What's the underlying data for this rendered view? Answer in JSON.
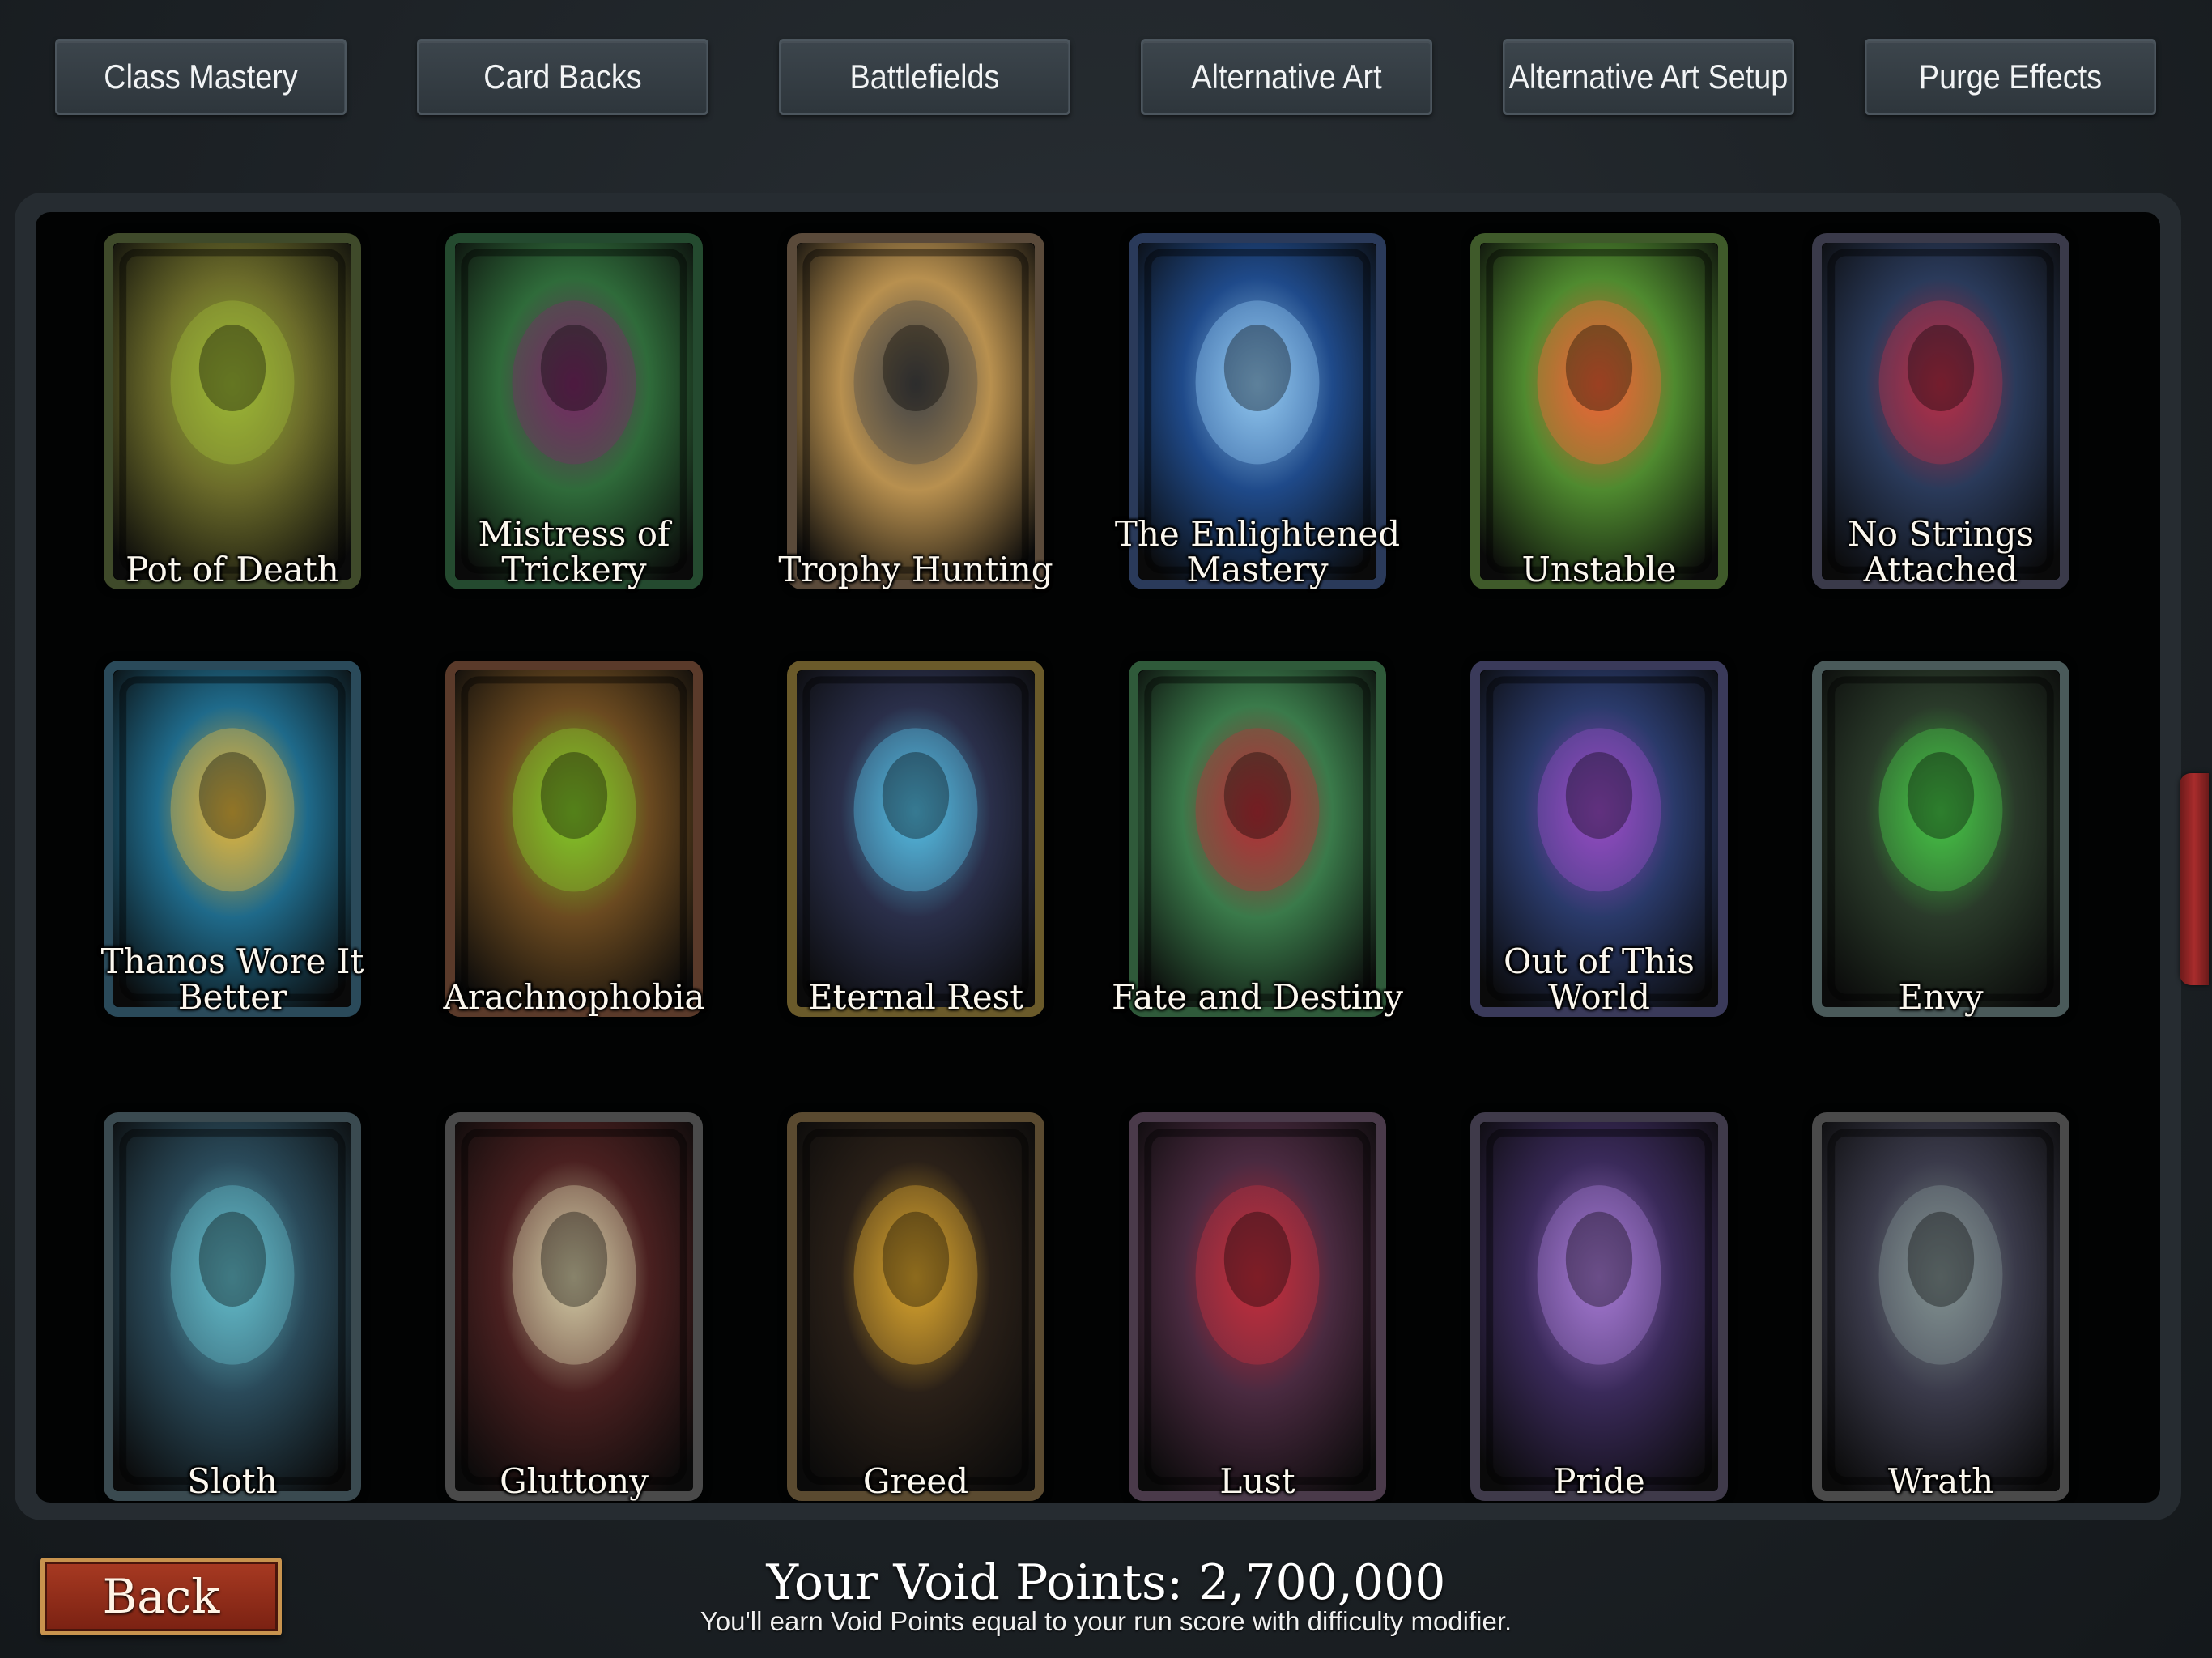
{
  "tabs": [
    {
      "label": "Class Mastery",
      "icon": "tab"
    },
    {
      "label": "Card Backs",
      "icon": "tab"
    },
    {
      "label": "Battlefields",
      "icon": "tab"
    },
    {
      "label": "Alternative Art",
      "icon": "tab"
    },
    {
      "label": "Alternative Art Setup",
      "icon": "tab"
    },
    {
      "label": "Purge Effects",
      "icon": "tab"
    }
  ],
  "cards": [
    {
      "name": "Pot of Death",
      "frame": "#3f4a2a",
      "bg": "#6b6b2a",
      "accent": "#a5c23a"
    },
    {
      "name": "Mistress of Trickery",
      "frame": "#244a2f",
      "bg": "#2f6b3a",
      "accent": "#7f2a6a"
    },
    {
      "name": "Trophy Hunting",
      "frame": "#5a4a3a",
      "bg": "#b8904f",
      "accent": "#4a4a4a"
    },
    {
      "name": "The Enlightened Mastery",
      "frame": "#2a3a5a",
      "bg": "#1f4a8a",
      "accent": "#9ad4ff"
    },
    {
      "name": "Unstable",
      "frame": "#3f5a2a",
      "bg": "#4f8a2f",
      "accent": "#ff6a3a"
    },
    {
      "name": "No Strings Attached",
      "frame": "#3a3a4a",
      "bg": "#2a3a5a",
      "accent": "#c0304a"
    },
    {
      "name": "Thanos Wore It Better",
      "frame": "#2a4a5a",
      "bg": "#1f6a8a",
      "accent": "#f0c040"
    },
    {
      "name": "Arachnophobia",
      "frame": "#5a3a2a",
      "bg": "#6b4a20",
      "accent": "#8ad42a"
    },
    {
      "name": "Eternal Rest",
      "frame": "#6a5a2a",
      "bg": "#2a2f4a",
      "accent": "#5ac8f0"
    },
    {
      "name": "Fate and Destiny",
      "frame": "#2f5a3a",
      "bg": "#3a7a4a",
      "accent": "#c0303a"
    },
    {
      "name": "Out of This World",
      "frame": "#3a3a5a",
      "bg": "#2a3a6a",
      "accent": "#a050d0"
    },
    {
      "name": "Envy",
      "frame": "#4a5a5a",
      "bg": "#2a3a2a",
      "accent": "#4ad04a"
    },
    {
      "name": "Sloth",
      "frame": "#3a4a50",
      "bg": "#2a4a5a",
      "accent": "#6ac8d8"
    },
    {
      "name": "Gluttony",
      "frame": "#4a4a4a",
      "bg": "#4a2020",
      "accent": "#e0d8b0"
    },
    {
      "name": "Greed",
      "frame": "#5a4a30",
      "bg": "#2a2018",
      "accent": "#e8b030"
    },
    {
      "name": "Lust",
      "frame": "#4a3a4a",
      "bg": "#4a2a40",
      "accent": "#d03040"
    },
    {
      "name": "Pride",
      "frame": "#3f3a4a",
      "bg": "#3a2a5a",
      "accent": "#b080e0"
    },
    {
      "name": "Wrath",
      "frame": "#4a4a4a",
      "bg": "#3a3a4a",
      "accent": "#8a9a9a"
    }
  ],
  "back_button": {
    "label": "Back"
  },
  "void_points": {
    "title": "Your Void Points: 2,700,000",
    "subtitle": "You'll earn Void Points equal to your run score with difficulty modifier."
  }
}
